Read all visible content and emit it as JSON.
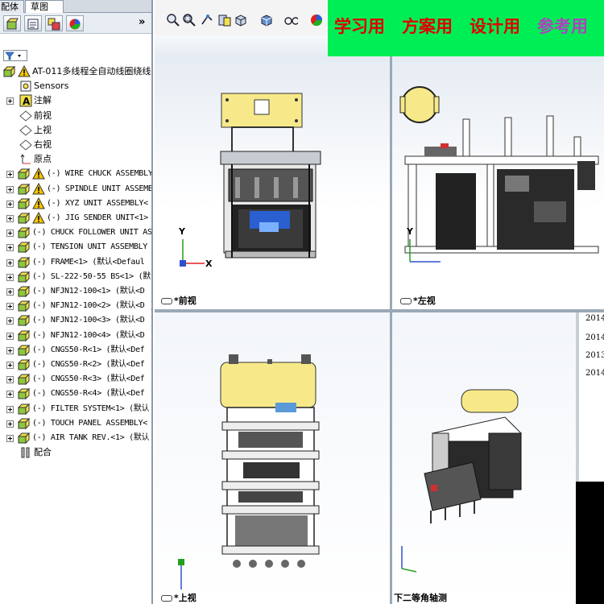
{
  "tabs": [
    "配体",
    "草图"
  ],
  "tree": {
    "root": "AT-011多线程全自动线圈绕线",
    "items": [
      {
        "label": "Sensors",
        "kind": "sensor",
        "indent": 1
      },
      {
        "label": "注解",
        "kind": "annotation",
        "indent": 1,
        "expandable": true
      },
      {
        "label": "前视",
        "kind": "plane",
        "indent": 1
      },
      {
        "label": "上视",
        "kind": "plane",
        "indent": 1
      },
      {
        "label": "右视",
        "kind": "plane",
        "indent": 1
      },
      {
        "label": "原点",
        "kind": "origin",
        "indent": 1
      }
    ],
    "components": [
      {
        "label": "(-) WIRE CHUCK ASSEMBLY",
        "warn": true
      },
      {
        "label": "(-) SPINDLE UNIT ASSEMB",
        "warn": true
      },
      {
        "label": "(-) XYZ  UNIT ASSEMBLY<",
        "warn": true
      },
      {
        "label": "(-) JIG SENDER UNIT<1>",
        "warn": true
      },
      {
        "label": "(-) CHUCK FOLLOWER UNIT AS",
        "warn": false
      },
      {
        "label": "(-) TENSION UNIT ASSEMBLY",
        "warn": false
      },
      {
        "label": "(-) FRAME<1> (默认<Defaul",
        "warn": false
      },
      {
        "label": "(-) SL-222-50-55 BS<1> (默",
        "warn": false
      },
      {
        "label": "(-) NFJN12-100<1> (默认<D",
        "warn": false
      },
      {
        "label": "(-) NFJN12-100<2> (默认<D",
        "warn": false
      },
      {
        "label": "(-) NFJN12-100<3> (默认<D",
        "warn": false
      },
      {
        "label": "(-) NFJN12-100<4> (默认<D",
        "warn": false
      },
      {
        "label": "(-) CNGS50-R<1> (默认<Def",
        "warn": false
      },
      {
        "label": "(-) CNGS50-R<2> (默认<Def",
        "warn": false
      },
      {
        "label": "(-) CNGS50-R<3> (默认<Def",
        "warn": false
      },
      {
        "label": "(-) CNGS50-R<4> (默认<Def",
        "warn": false
      },
      {
        "label": "(-) FILTER SYSTEM<1> (默认",
        "warn": false
      },
      {
        "label": "(-) TOUCH PANEL ASSEMBLY<",
        "warn": false
      },
      {
        "label": "(-) AIR TANK REV.<1> (默认",
        "warn": false
      }
    ],
    "mates": "配合"
  },
  "banner": {
    "items": [
      {
        "text": "学习用",
        "color": "#e00000"
      },
      {
        "text": "方案用",
        "color": "#e00000"
      },
      {
        "text": "设计用",
        "color": "#e00000"
      },
      {
        "text": "参考用",
        "color": "#b040c0"
      }
    ]
  },
  "viewports": {
    "front": "*前视",
    "left": "*左视",
    "top": "*上视",
    "iso": "下二等角轴测"
  },
  "axis": {
    "x": "X",
    "y": "Y"
  },
  "log": [
    "2014",
    "2014",
    "2013",
    "2014"
  ],
  "colors": {
    "accent_green": "#00ee55",
    "warning": "#f5c400",
    "component": "#d8d020",
    "frame_blue": "#2050c0"
  }
}
